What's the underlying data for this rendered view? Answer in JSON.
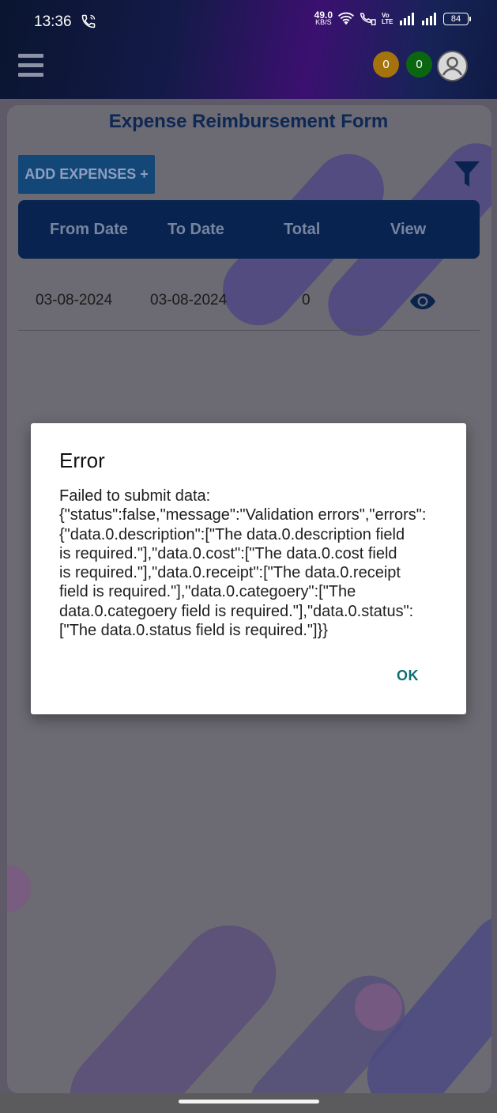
{
  "status_bar": {
    "time": "13:36",
    "net_speed_value": "49.0",
    "net_speed_unit": "KB/S",
    "battery": "84",
    "volte_label": "Vo LTE"
  },
  "header": {
    "badge_orange_count": "0",
    "badge_green_count": "0"
  },
  "page": {
    "title": "Expense Reimbursement Form",
    "add_button_label": "ADD EXPENSES +"
  },
  "table": {
    "columns": [
      "From Date",
      "To Date",
      "Total",
      "View"
    ],
    "rows": [
      {
        "from_date": "03-08-2024",
        "to_date": "03-08-2024",
        "total": "0"
      }
    ]
  },
  "dialog": {
    "title": "Error",
    "message": "Failed to submit data:\n{\"status\":false,\"message\":\"Validation errors\",\"errors\":\n{\"data.0.description\":[\"The data.0.description field\nis required.\"],\"data.0.cost\":[\"The data.0.cost field\nis required.\"],\"data.0.receipt\":[\"The data.0.receipt\nfield is required.\"],\"data.0.categoery\":[\"The\ndata.0.categoery field is required.\"],\"data.0.status\":\n[\"The data.0.status field is required.\"]}}",
    "ok_label": "OK"
  },
  "colors": {
    "header_purple": "#3b1070",
    "table_header": "#08234f",
    "add_button": "#134777",
    "ok_text": "#0f6f73"
  }
}
